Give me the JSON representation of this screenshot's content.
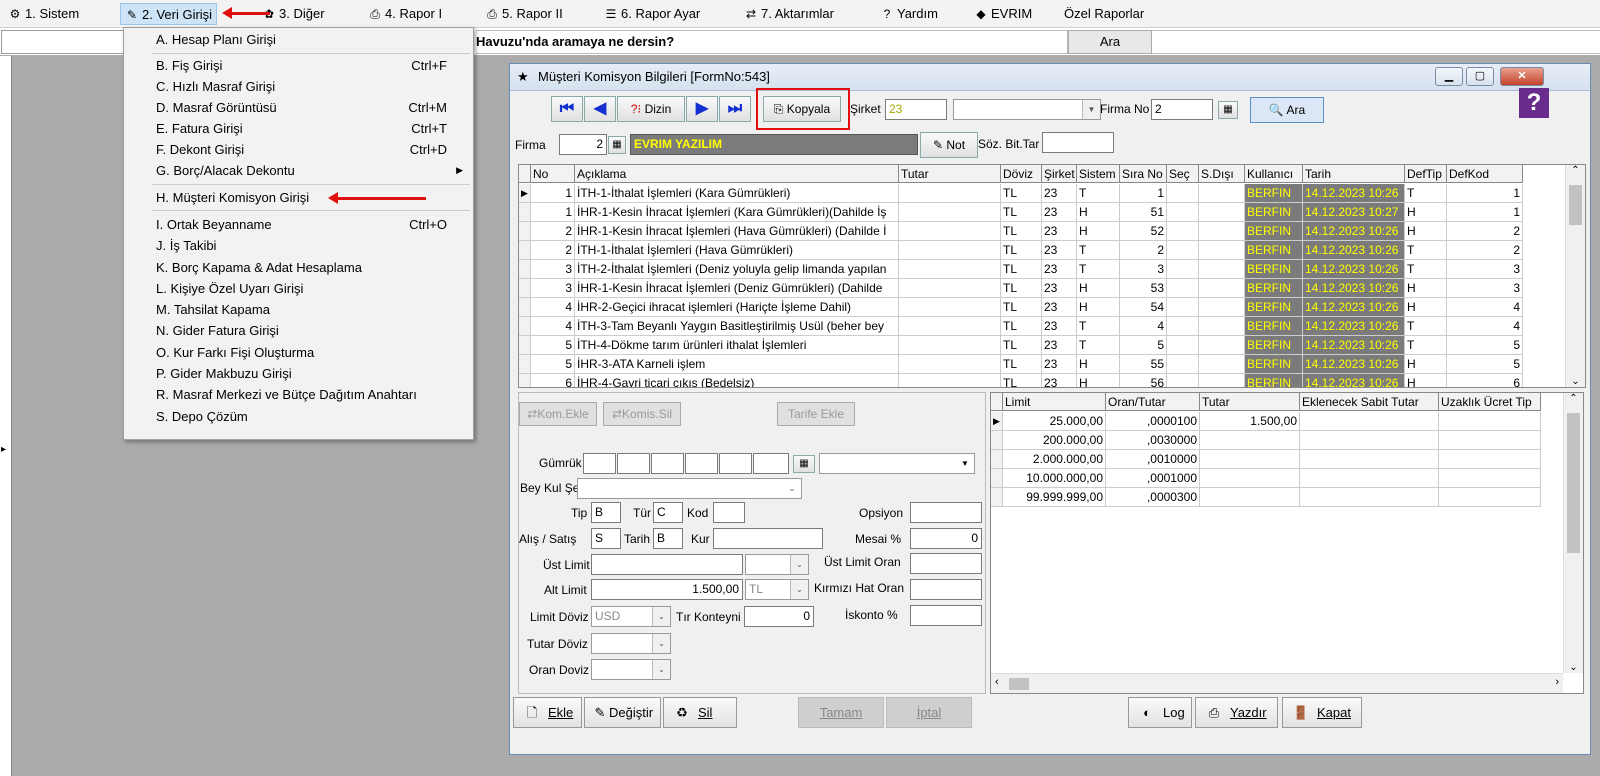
{
  "menubar": {
    "items": [
      {
        "label": "1.  Sistem",
        "icon": "system-icon"
      },
      {
        "label": "2.  Veri Girişi",
        "icon": "data-entry-icon"
      },
      {
        "label": "3.  Diğer",
        "icon": "other-icon"
      },
      {
        "label": "4.  Rapor I",
        "icon": "printer-icon"
      },
      {
        "label": "5.  Rapor II",
        "icon": "printer-icon"
      },
      {
        "label": "6.  Rapor Ayar",
        "icon": "report-settings-icon"
      },
      {
        "label": "7.  Aktarımlar",
        "icon": "transfer-icon"
      },
      {
        "label": "Yardım",
        "icon": "help-icon"
      },
      {
        "label": "EVRIM",
        "icon": "evrim-icon"
      },
      {
        "label": "Özel Raporlar",
        "icon": ""
      }
    ]
  },
  "search": {
    "text": "Havuzu'nda aramaya ne dersin?",
    "button": "Ara"
  },
  "dropdown": {
    "items": [
      {
        "label": "A.  Hesap Planı Girişi",
        "shortcut": ""
      },
      {
        "label": "B.  Fiş Girişi",
        "shortcut": "Ctrl+F"
      },
      {
        "label": "C.  Hızlı Masraf Girişi",
        "shortcut": ""
      },
      {
        "label": "D.  Masraf Görüntüsü",
        "shortcut": "Ctrl+M"
      },
      {
        "label": "E.  Fatura Girişi",
        "shortcut": "Ctrl+T"
      },
      {
        "label": "F.  Dekont Girişi",
        "shortcut": "Ctrl+D"
      },
      {
        "label": "G.  Borç/Alacak Dekontu",
        "shortcut": ""
      },
      {
        "label": "H.  Müşteri Komisyon Girişi",
        "shortcut": ""
      },
      {
        "label": "I.  Ortak Beyanname",
        "shortcut": "Ctrl+O"
      },
      {
        "label": "J.  İş Takibi",
        "shortcut": ""
      },
      {
        "label": "K.  Borç Kapama & Adat Hesaplama",
        "shortcut": ""
      },
      {
        "label": "L.  Kişiye Özel Uyarı Girişi",
        "shortcut": ""
      },
      {
        "label": "M.  Tahsilat Kapama",
        "shortcut": ""
      },
      {
        "label": "N. Gider Fatura Girişi",
        "shortcut": ""
      },
      {
        "label": "O. Kur Farkı Fişi Oluşturma",
        "shortcut": ""
      },
      {
        "label": "P. Gider Makbuzu Girişi",
        "shortcut": ""
      },
      {
        "label": "R. Masraf Merkezi ve Bütçe Dağıtım Anahtarı",
        "shortcut": ""
      },
      {
        "label": "S. Depo Çözüm",
        "shortcut": ""
      }
    ]
  },
  "form": {
    "title": "Müşteri Komisyon Bilgileri [FormNo:543]",
    "toolbar": {
      "dizin": "Dizin",
      "kopyala": "Kopyala",
      "sirket_label": "Şirket",
      "sirket_value": "23",
      "firma_no_label": "Firma No",
      "firma_no_value": "2",
      "ara": "Ara"
    },
    "firma": {
      "label": "Firma",
      "value": "2",
      "name": "EVRIM YAZILIM",
      "not": "Not",
      "soz_label": "Söz. Bit.Tar"
    },
    "grid": {
      "headers": [
        "No",
        "Açıklama",
        "Tutar",
        "Döviz",
        "Şirket",
        "Sistem",
        "Sıra No",
        "Seç",
        "S.Dışı",
        "Kullanıcı",
        "Tarih",
        "DefTip",
        "DefKod"
      ],
      "rows": [
        [
          "1",
          "İTH-1-İthalat İşlemleri  (Kara Gümrükleri)",
          "",
          "TL",
          "23",
          "T",
          "1",
          "",
          "",
          "BERFIN",
          "14.12.2023 10:26",
          "T",
          "1"
        ],
        [
          "1",
          "İHR-1-Kesin İhracat İşlemleri (Kara Gümrükleri)(Dahilde İş",
          "",
          "TL",
          "23",
          "H",
          "51",
          "",
          "",
          "BERFIN",
          "14.12.2023 10:27",
          "H",
          "1"
        ],
        [
          "2",
          "İHR-1-Kesin İhracat İşlemleri (Hava Gümrükleri) (Dahilde İ",
          "",
          "TL",
          "23",
          "H",
          "52",
          "",
          "",
          "BERFIN",
          "14.12.2023 10:26",
          "H",
          "2"
        ],
        [
          "2",
          "İTH-1-İthalat İşlemleri  (Hava Gümrükleri)",
          "",
          "TL",
          "23",
          "T",
          "2",
          "",
          "",
          "BERFIN",
          "14.12.2023 10:26",
          "T",
          "2"
        ],
        [
          "3",
          "İTH-2-İthalat İşlemleri (Deniz yoluyla gelip limanda yapılan",
          "",
          "TL",
          "23",
          "T",
          "3",
          "",
          "",
          "BERFIN",
          "14.12.2023 10:26",
          "T",
          "3"
        ],
        [
          "3",
          "İHR-1-Kesin İhracat İşlemleri (Deniz Gümrükleri) (Dahilde",
          "",
          "TL",
          "23",
          "H",
          "53",
          "",
          "",
          "BERFIN",
          "14.12.2023 10:26",
          "H",
          "3"
        ],
        [
          "4",
          "İHR-2-Geçici ihracat işlemleri (Hariçte İşleme Dahil)",
          "",
          "TL",
          "23",
          "H",
          "54",
          "",
          "",
          "BERFIN",
          "14.12.2023 10:26",
          "H",
          "4"
        ],
        [
          "4",
          "İTH-3-Tam Beyanlı Yaygın Basitleştirilmiş Usül (beher bey",
          "",
          "TL",
          "23",
          "T",
          "4",
          "",
          "",
          "BERFIN",
          "14.12.2023 10:26",
          "T",
          "4"
        ],
        [
          "5",
          "İTH-4-Dökme tarım ürünleri ithalat İşlemleri",
          "",
          "TL",
          "23",
          "T",
          "5",
          "",
          "",
          "BERFIN",
          "14.12.2023 10:26",
          "T",
          "5"
        ],
        [
          "5",
          "İHR-3-ATA Karneli işlem",
          "",
          "TL",
          "23",
          "H",
          "55",
          "",
          "",
          "BERFIN",
          "14.12.2023 10:26",
          "H",
          "5"
        ],
        [
          "6",
          "İHR-4-Gayri ticari çıkış (Bedelsiz)",
          "",
          "TL",
          "23",
          "H",
          "56",
          "",
          "",
          "BERFIN",
          "14.12.2023 10:26",
          "H",
          "6"
        ]
      ]
    },
    "lower": {
      "kom_ekle": "Kom.Ekle",
      "komis_sil": "Komis.Sil",
      "tarife_ekle": "Tarife Ekle",
      "gumruk": "Gümrük",
      "bey_kul_sek": "Bey Kul Şek",
      "tip_label": "Tip",
      "tip_value": "B",
      "tur_label": "Tür",
      "tur_value": "C",
      "kod_label": "Kod",
      "alis_satis_label": "Alış / Satış",
      "alis_satis_value": "S",
      "tarih_label": "Tarih",
      "tarih_value": "B",
      "kur_label": "Kur",
      "ust_limit": "Üst Limit",
      "alt_limit": "Alt Limit",
      "alt_limit_value": "1.500,00",
      "alt_limit_cur": "TL",
      "limit_doviz": "Limit Döviz",
      "limit_doviz_value": "USD",
      "tir_konteyni": "Tır Konteyni",
      "tir_value": "0",
      "tutar_doviz": "Tutar Döviz",
      "oran_doviz": "Oran Doviz",
      "opsiyon": "Opsiyon",
      "mesai": "Mesai %",
      "mesai_value": "0",
      "ust_limit_oran": "Üst Limit Oran",
      "kirmizi_hat_oran": "Kırmızı Hat Oran",
      "iskonto": "İskonto %"
    },
    "limitgrid": {
      "headers": [
        "Limit",
        "Oran/Tutar",
        "Tutar",
        "Eklenecek Sabit Tutar",
        "Uzaklık Ücret Tip"
      ],
      "rows": [
        [
          "25.000,00",
          ",0000100",
          "1.500,00",
          "",
          ""
        ],
        [
          "200.000,00",
          ",0030000",
          "",
          "",
          ""
        ],
        [
          "2.000.000,00",
          ",0010000",
          "",
          "",
          ""
        ],
        [
          "10.000.000,00",
          ",0001000",
          "",
          "",
          ""
        ],
        [
          "99.999.999,00",
          ",0000300",
          "",
          "",
          ""
        ]
      ]
    },
    "bottom": {
      "ekle": "Ekle",
      "degistir": "Değiştir",
      "sil": "Sil",
      "tamam": "Tamam",
      "iptal": "İptal",
      "log": "Log",
      "yazdir": "Yazdır",
      "kapat": "Kapat"
    }
  },
  "colors": {
    "highlight_cell": "#7b7b7b",
    "highlight_text": "#ffff00",
    "annotation": "#e01010",
    "firma_name_bg": "#7b7b7b"
  }
}
